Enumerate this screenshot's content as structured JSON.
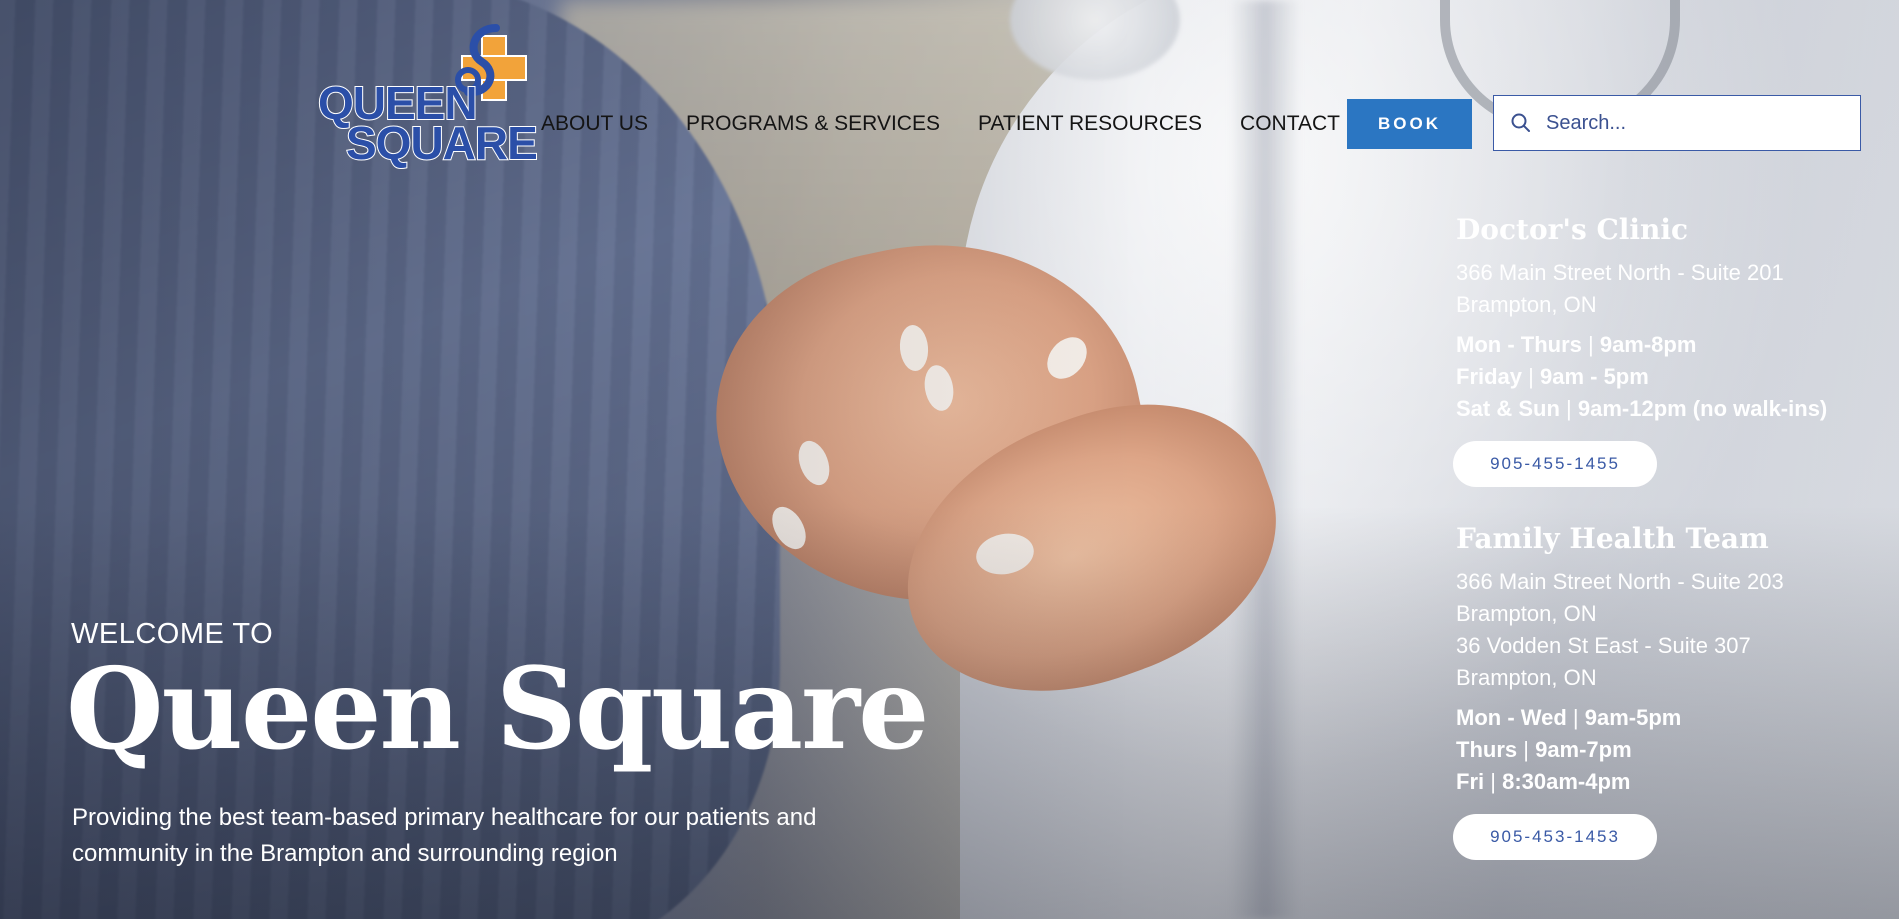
{
  "brand": {
    "logo_line1": "QUEEN",
    "logo_line2": "SQUARE",
    "colors": {
      "blue": "#2b4fa8",
      "orange": "#f2a33a",
      "book_button": "#2b76c2"
    }
  },
  "nav": {
    "items": [
      "ABOUT US",
      "PROGRAMS & SERVICES",
      "PATIENT RESOURCES",
      "CONTACT"
    ]
  },
  "header": {
    "book_label": "BOOK",
    "search_placeholder": "Search..."
  },
  "hero": {
    "welcome": "WELCOME TO",
    "title": "Queen Square",
    "subtitle_line1": "Providing the best team-based primary healthcare for our patients and",
    "subtitle_line2": "community in the Brampton and surrounding region"
  },
  "locations": [
    {
      "name": "Doctor's Clinic",
      "address": [
        "366 Main Street North - Suite 201",
        "Brampton, ON"
      ],
      "hours": [
        {
          "days": "Mon - Thurs",
          "sep": " | ",
          "time": "9am-8pm"
        },
        {
          "days": "Friday",
          "sep": " | ",
          "time": "9am - 5pm"
        },
        {
          "days": "Sat & Sun",
          "sep": " | ",
          "time": "9am-12pm (no walk-ins)"
        }
      ],
      "phone": "905-455-1455"
    },
    {
      "name": "Family Health Team",
      "address": [
        "366 Main Street North - Suite 203",
        "Brampton, ON",
        "36 Vodden St East - Suite 307",
        "Brampton, ON"
      ],
      "hours": [
        {
          "days": "Mon - Wed",
          "sep": " | ",
          "time": "9am-5pm"
        },
        {
          "days": "Thurs",
          "sep": " | ",
          "time": "9am-7pm"
        },
        {
          "days": "Fri",
          "sep": " | ",
          "time": "8:30am-4pm"
        }
      ],
      "phone": "905-453-1453"
    }
  ]
}
